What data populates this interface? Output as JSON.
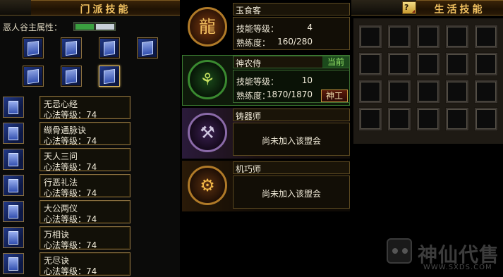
{
  "sect_panel": {
    "title": "门派技能",
    "help_label": "?",
    "property_label": "恶人谷主属性：",
    "skills": [
      {
        "name": "无忌心经",
        "level": "心法等级：74"
      },
      {
        "name": "缬骨通脉诀",
        "level": "心法等级：74"
      },
      {
        "name": "天人三问",
        "level": "心法等级：74"
      },
      {
        "name": "行恶礼法",
        "level": "心法等级：74"
      },
      {
        "name": "大公两仪",
        "level": "心法等级：74"
      },
      {
        "name": "万相诀",
        "level": "心法等级：74"
      },
      {
        "name": "无尽诀",
        "level": "心法等级：74"
      }
    ]
  },
  "professions": [
    {
      "name": "玉食客",
      "skill_level_label": "技能等级：",
      "skill_level": "4",
      "proficiency_label": "熟练度：",
      "proficiency": "160/280",
      "emblem_icon": "dragon-emblem-icon",
      "accent": "#b07a28"
    },
    {
      "name": "神农侍",
      "status": "当前",
      "skill_level_label": "技能等级：",
      "skill_level": "10",
      "proficiency_label": "熟练度：",
      "proficiency": "1870/1870",
      "action_label": "神工",
      "emblem_icon": "herb-emblem-icon",
      "accent": "#3a8a30"
    },
    {
      "name": "铸器师",
      "message": "尚未加入该盟会",
      "emblem_icon": "forge-emblem-icon",
      "accent": "#7a4aa0"
    },
    {
      "name": "机巧师",
      "message": "尚未加入该盟会",
      "emblem_icon": "gear-emblem-icon",
      "accent": "#b07a28"
    }
  ],
  "life_panel": {
    "title": "生活技能",
    "help_label": "?"
  },
  "watermark": {
    "brand": "神仙代售",
    "site": "WWW.SXDS.COM"
  }
}
